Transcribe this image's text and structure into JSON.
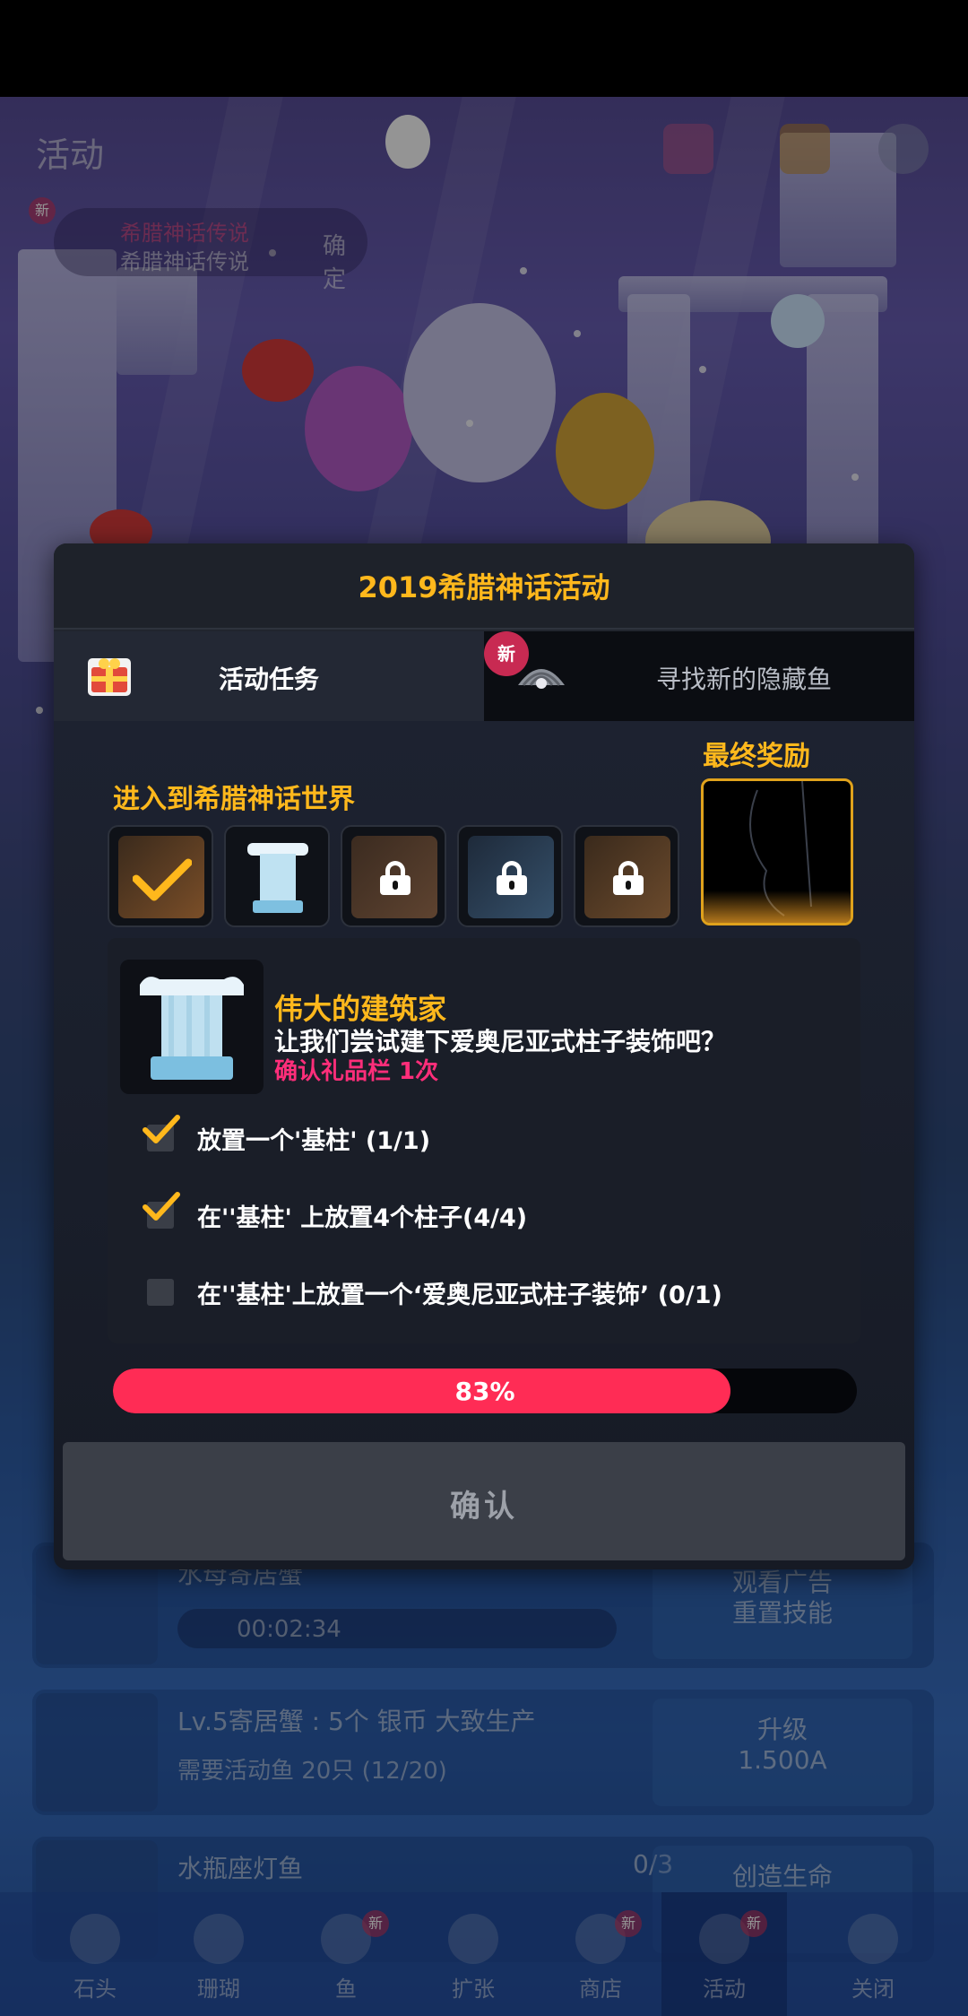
{
  "background": {
    "header_title": "活动",
    "news_line1": "希腊神话传说",
    "news_line2": "希腊神话传说",
    "news_confirm": "确定",
    "news_badge": "新",
    "rows": [
      {
        "title": "水母寄居蟹",
        "timer": "00:02:34",
        "button": "观看广告\n重置技能"
      },
      {
        "title": "Lv.5寄居蟹 : 5个 银币 大致生产",
        "sub": "需要活动鱼 20只 (12/20)",
        "button_line1": "升级",
        "button_line2": "1.500A"
      },
      {
        "title": "水瓶座灯鱼",
        "count": "0/3",
        "button": "创造生命"
      }
    ],
    "tabs": [
      "石头",
      "珊瑚",
      "鱼",
      "扩张",
      "商店",
      "活动",
      "关闭"
    ],
    "tab_badge": "新"
  },
  "dialog": {
    "title": "2019希腊神话活动",
    "tab_tasks": "活动任务",
    "tab_hidden_fish": "寻找新的隐藏鱼",
    "tab_new_badge": "新",
    "section_title": "进入到希腊神话世界",
    "final_reward_title": "最终奖励",
    "quest": {
      "title": "伟大的建筑家",
      "desc": "让我们尝试建下爱奥尼亚式柱子装饰吧？",
      "reward": "确认礼品栏 1次",
      "tasks": [
        {
          "label": "放置一个'基柱' (1/1)",
          "done": true
        },
        {
          "label": "在''基柱' 上放置4个柱子(4/4)",
          "done": true
        },
        {
          "label": "在''基柱'上放置一个‘爱奥尼亚式柱子装饰’ (0/1)",
          "done": false
        }
      ]
    },
    "progress": {
      "value": 0.83,
      "label": "83%"
    },
    "confirm_label": "确认"
  },
  "colors": {
    "accent": "#ffb81c",
    "progress": "#ff2c55",
    "reward_pink": "#ff2e7a"
  }
}
